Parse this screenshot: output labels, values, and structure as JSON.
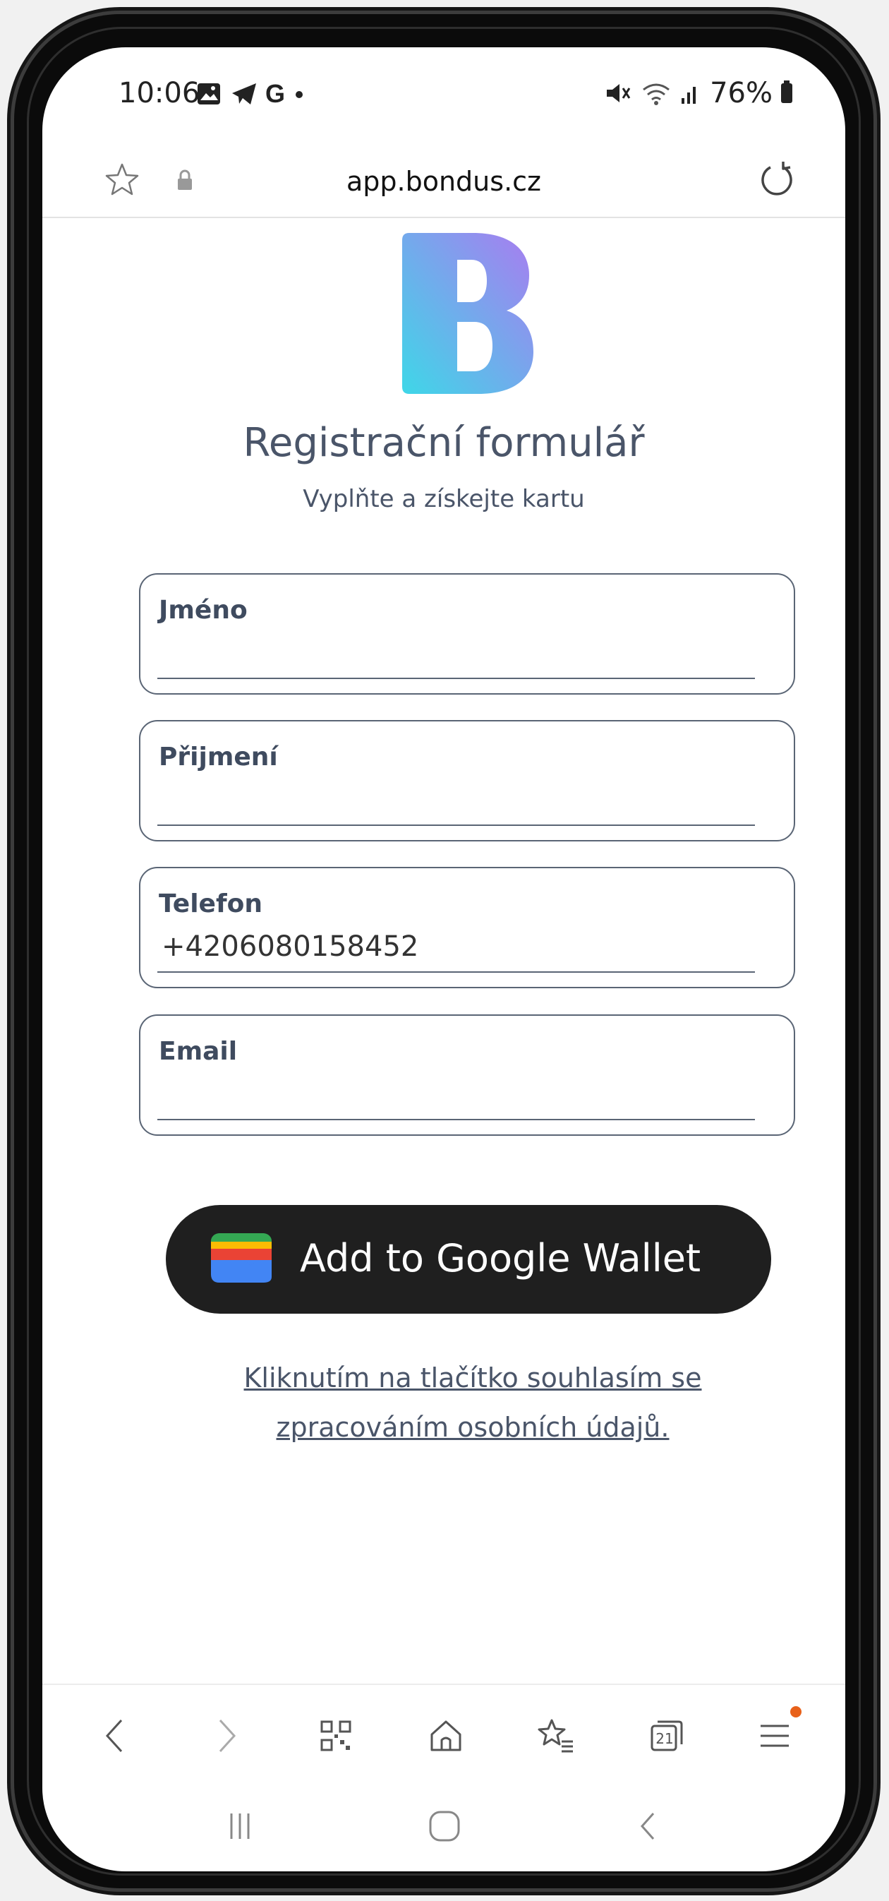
{
  "status_bar": {
    "time": "10:06",
    "battery": "76%"
  },
  "browser": {
    "url": "app.bondus.cz"
  },
  "brand": {
    "logo_letter": "B",
    "logo_gradient": [
      "#3ed7e8",
      "#a97cf0"
    ]
  },
  "form": {
    "title": "Registrační formulář",
    "subtitle": "Vyplňte a získejte kartu",
    "fields": [
      {
        "label": "Jméno",
        "value": ""
      },
      {
        "label": "Přijmení",
        "value": ""
      },
      {
        "label": "Telefon",
        "value": "+4206080158452"
      },
      {
        "label": "Email",
        "value": ""
      }
    ],
    "wallet_button_label": "Add to Google Wallet",
    "consent_line1": "Kliknutím na tlačítko souhlasím se",
    "consent_line2": "zpracováním osobních údajů."
  },
  "bottom_nav": {
    "tabs_count": "21",
    "items": [
      "back-icon",
      "forward-icon",
      "qr-code-icon",
      "home-icon",
      "bookmarks-icon",
      "tabs-icon",
      "menu-icon"
    ]
  },
  "colors": {
    "accent_text": "#4a5569",
    "wallet_bg": "#1f1f1f",
    "notification_dot": "#e8611a"
  }
}
